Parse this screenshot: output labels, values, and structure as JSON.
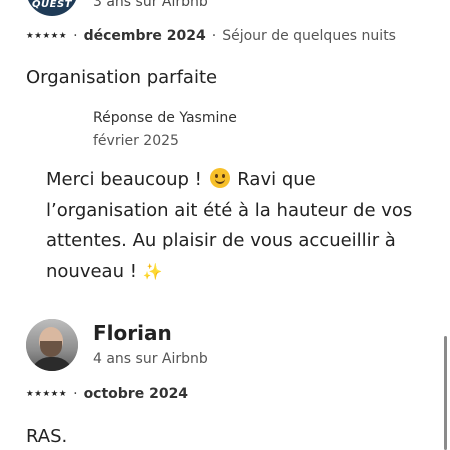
{
  "review_top": {
    "avatar_logo_text": "QUEST",
    "tenure": "3 ans sur Airbnb",
    "stars": "★★★★★",
    "date": "décembre 2024",
    "stay_type": "Séjour de quelques nuits",
    "text": "Organisation parfaite"
  },
  "reply": {
    "author": "Réponse de Yasmine",
    "date": "février 2025",
    "text_part1": "Merci beaucoup ! ",
    "text_part2": " Ravi que l’organisation ait été à la hauteur de vos attentes. Au plaisir de vous accueillir à nouveau ! ",
    "sparkle": "✨"
  },
  "review_florian": {
    "name": "Florian",
    "tenure": "4 ans sur Airbnb",
    "stars": "★★★★★",
    "date": "octobre 2024",
    "text": "RAS."
  },
  "separator": "·",
  "icons": {
    "emoji": "smiling-face-icon",
    "sparkle": "sparkles-icon"
  },
  "colors": {
    "text": "#222222",
    "secondary": "#555555",
    "emoji_yellow": "#f7c02a"
  }
}
